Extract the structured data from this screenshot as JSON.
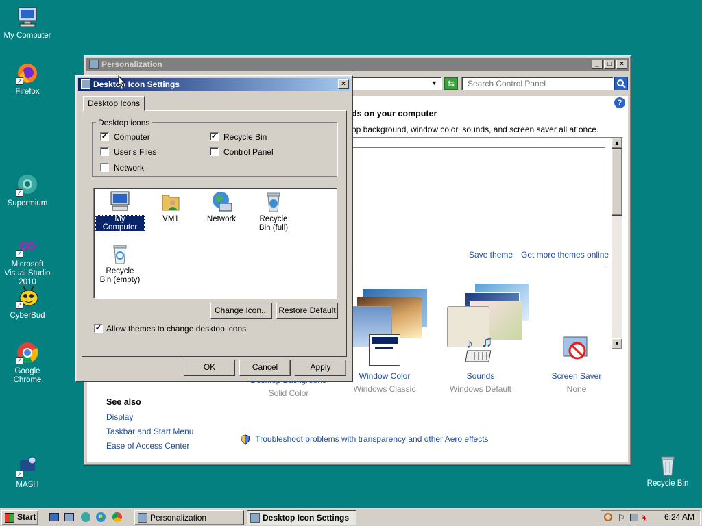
{
  "desktop": {
    "icons": [
      {
        "label": "My Computer",
        "icon": "computer-icon"
      },
      {
        "label": "Firefox",
        "icon": "firefox-icon"
      },
      {
        "label": "Supermium",
        "icon": "supermium-icon"
      },
      {
        "label": "Microsoft Visual Studio 2010",
        "icon": "visual-studio-icon"
      },
      {
        "label": "CyberBud",
        "icon": "cyberbud-icon"
      },
      {
        "label": "Google Chrome",
        "icon": "chrome-icon"
      },
      {
        "label": "MASH",
        "icon": "mash-icon"
      },
      {
        "label": "Recycle Bin",
        "icon": "recycle-bin-icon"
      }
    ]
  },
  "personalization": {
    "title": "Personalization",
    "search_placeholder": "Search Control Panel",
    "heading": "ds on your computer",
    "subheading": "op background, window color, sounds, and screen saver all at once.",
    "save_theme": "Save theme",
    "get_more_themes": "Get more themes online",
    "see_also": {
      "title": "See also",
      "links": [
        "Display",
        "Taskbar and Start Menu",
        "Ease of Access Center"
      ]
    },
    "settings": [
      {
        "label": "Desktop Background",
        "value": "Solid Color",
        "icon": "desktop-background-icon"
      },
      {
        "label": "Window Color",
        "value": "Windows Classic",
        "icon": "window-color-icon"
      },
      {
        "label": "Sounds",
        "value": "Windows Default",
        "icon": "sounds-icon"
      },
      {
        "label": "Screen Saver",
        "value": "None",
        "icon": "screen-saver-icon"
      }
    ],
    "troubleshoot": "Troubleshoot problems with transparency and other Aero effects"
  },
  "dialog": {
    "title": "Desktop Icon Settings",
    "tab": "Desktop Icons",
    "group_title": "Desktop icons",
    "checkboxes": [
      {
        "label": "Computer",
        "checked": true
      },
      {
        "label": "Recycle Bin",
        "checked": true
      },
      {
        "label": "User's Files",
        "checked": false
      },
      {
        "label": "Control Panel",
        "checked": false
      },
      {
        "label": "Network",
        "checked": false
      }
    ],
    "icon_list": [
      {
        "label": "My Computer",
        "selected": true
      },
      {
        "label": "VM1",
        "selected": false
      },
      {
        "label": "Network",
        "selected": false
      },
      {
        "label": "Recycle Bin (full)",
        "selected": false
      },
      {
        "label": "Recycle Bin (empty)",
        "selected": false
      }
    ],
    "change_icon": "Change Icon...",
    "restore_default": "Restore Default",
    "allow_themes": "Allow themes to change desktop icons",
    "allow_themes_checked": true,
    "ok": "OK",
    "cancel": "Cancel",
    "apply": "Apply"
  },
  "taskbar": {
    "start": "Start",
    "tasks": [
      {
        "label": "Personalization",
        "active": false
      },
      {
        "label": "Desktop Icon Settings",
        "active": true
      }
    ],
    "clock": "6:24 AM"
  },
  "colors": {
    "desktop": "#058080",
    "title_active": "#0a246a",
    "title_inactive": "#808080",
    "face": "#d4d0c8",
    "link": "#1b4e9f"
  }
}
